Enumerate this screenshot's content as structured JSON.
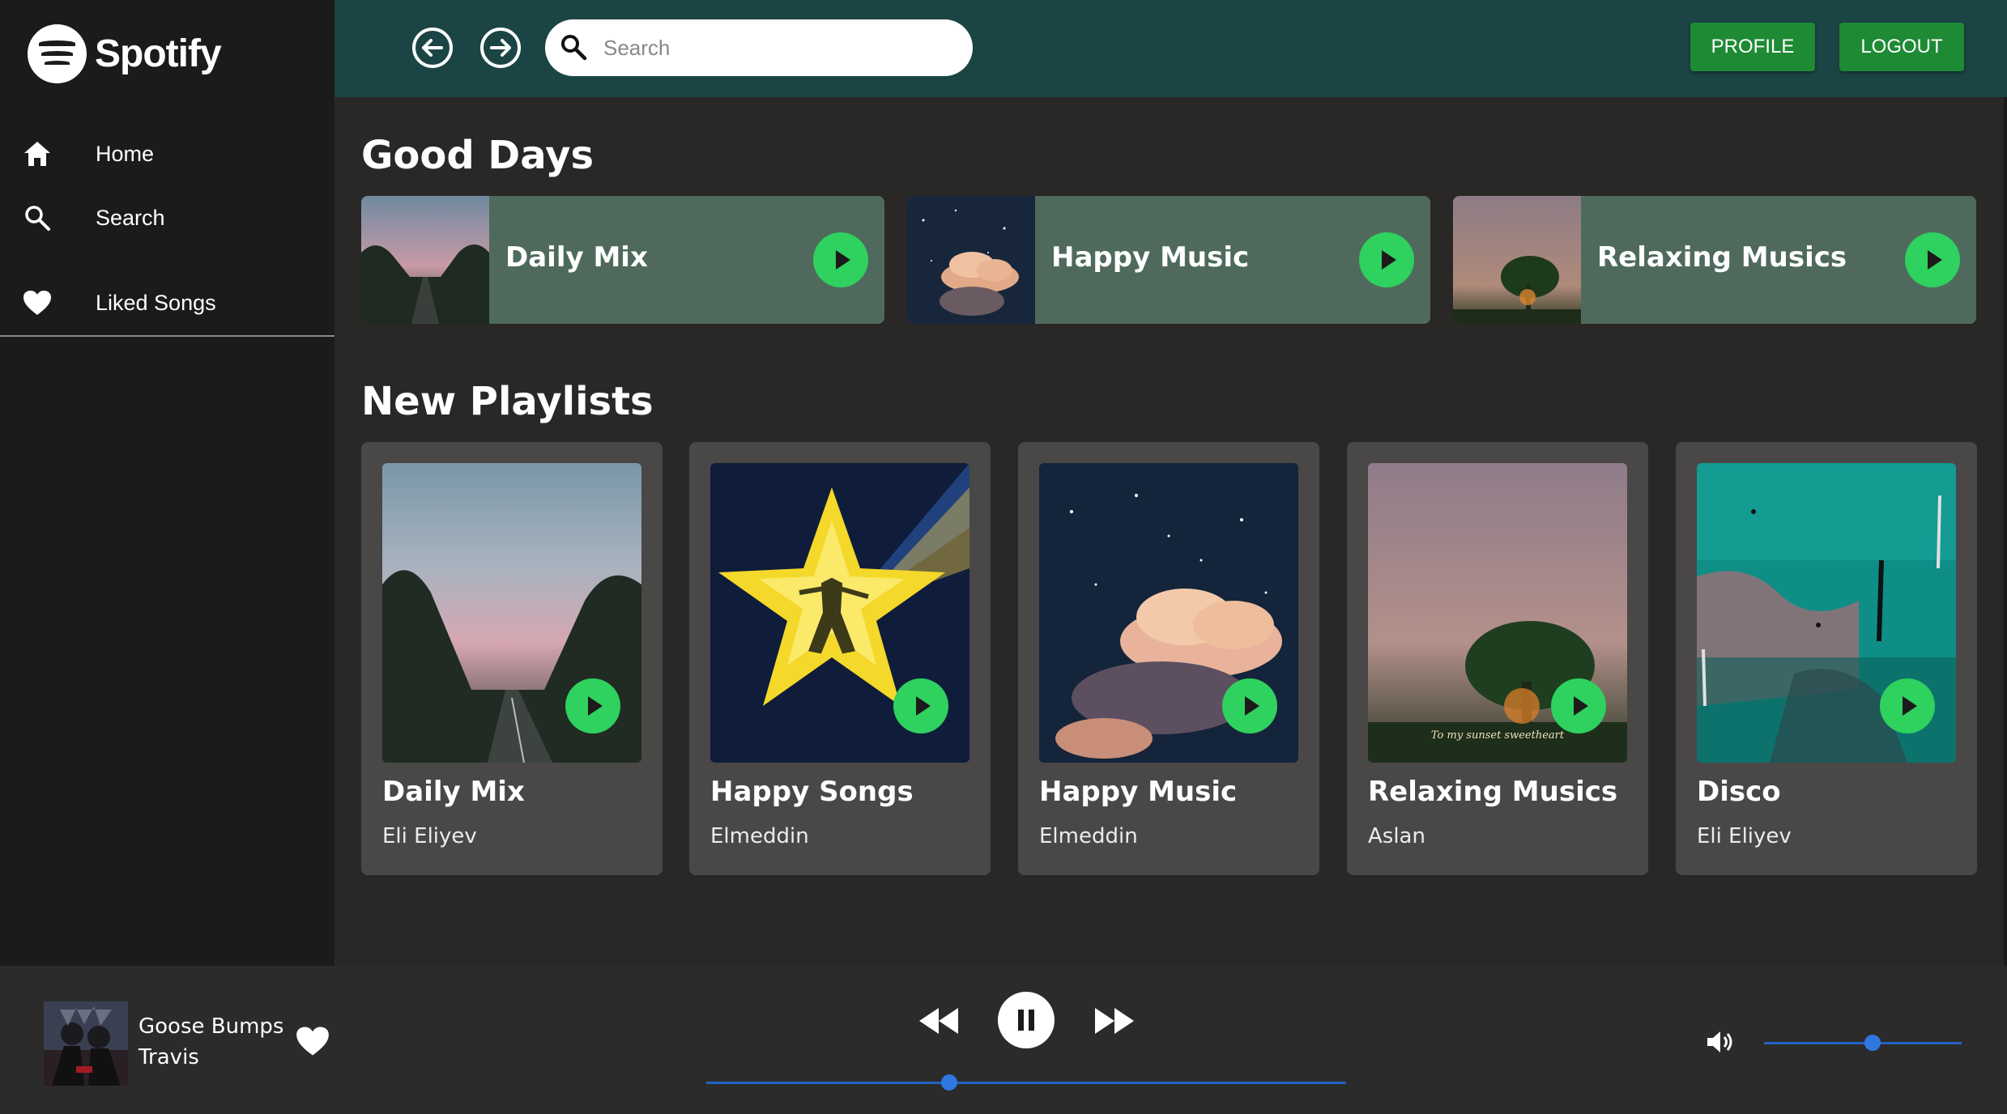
{
  "app": {
    "name": "Spotify"
  },
  "sidebar": {
    "items": [
      {
        "label": "Home",
        "icon": "home-icon"
      },
      {
        "label": "Search",
        "icon": "search-icon"
      },
      {
        "label": "Liked Songs",
        "icon": "heart-icon"
      }
    ]
  },
  "topbar": {
    "search_placeholder": "Search",
    "profile_label": "PROFILE",
    "logout_label": "LOGOUT"
  },
  "good_days": {
    "title": "Good Days",
    "cards": [
      {
        "title": "Daily Mix"
      },
      {
        "title": "Happy Music"
      },
      {
        "title": "Relaxing Musics"
      }
    ]
  },
  "new_playlists": {
    "title": "New Playlists",
    "cards": [
      {
        "title": "Daily Mix",
        "subtitle": "Eli Eliyev"
      },
      {
        "title": "Happy Songs",
        "subtitle": "Elmeddin"
      },
      {
        "title": "Happy Music",
        "subtitle": "Elmeddin"
      },
      {
        "title": "Relaxing Musics",
        "subtitle": "Aslan"
      },
      {
        "title": "Disco",
        "subtitle": "Eli Eliyev"
      }
    ],
    "art_caption": "To my sunset sweetheart"
  },
  "player": {
    "song": "Goose Bumps",
    "artist": "Travis",
    "progress": 0.38,
    "volume": 0.55
  },
  "colors": {
    "sidebar_bg": "#1c1a1a",
    "topbar_bg": "#1b4545",
    "card_green": "#4f6a5c",
    "play_green": "#2fd15f",
    "button_green": "#1e8a34",
    "slider_blue": "#2362c4"
  }
}
